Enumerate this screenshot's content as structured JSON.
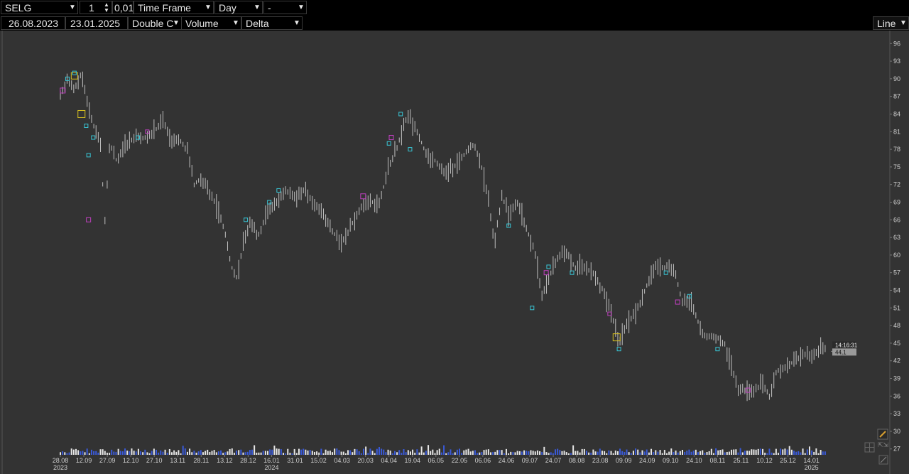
{
  "toolbar": {
    "symbol": "SELG",
    "multiplier": "1",
    "tick_size": "0,01",
    "timeframe_label": "Time Frame",
    "period": "Day",
    "extra": "-",
    "date_from": "26.08.2023",
    "date_to": "23.01.2025",
    "chart_style": "Double C",
    "volume_label": "Volume",
    "delta_label": "Delta",
    "draw_mode": "Line"
  },
  "price_label": {
    "time": "14:16:31",
    "price": "44,1"
  },
  "colors": {
    "background": "#333333",
    "toolbar": "#000000",
    "bar": "#bfbfbf",
    "cyan_marker": "#39c6d6",
    "magenta_marker": "#c040c0",
    "yellow_marker": "#d8c020",
    "volume_white": "#e6e6e6",
    "volume_blue": "#3a5ad8",
    "last_price_bg": "#9a9a9a"
  },
  "chart_data": {
    "type": "line",
    "ylim": [
      26,
      97
    ],
    "y_ticks": [
      "96",
      "93",
      "90",
      "87",
      "84",
      "81",
      "78",
      "75",
      "72",
      "69",
      "66",
      "63",
      "60",
      "57",
      "54",
      "51",
      "48",
      "45",
      "42",
      "39",
      "36",
      "33",
      "30",
      "27"
    ],
    "x_ticks": [
      {
        "label": "28.08",
        "sub": "2023"
      },
      {
        "label": "12.09"
      },
      {
        "label": "27.09"
      },
      {
        "label": "12.10"
      },
      {
        "label": "27.10"
      },
      {
        "label": "13.11"
      },
      {
        "label": "28.11"
      },
      {
        "label": "13.12"
      },
      {
        "label": "28.12"
      },
      {
        "label": "16.01",
        "sub": "2024"
      },
      {
        "label": "31.01"
      },
      {
        "label": "15.02"
      },
      {
        "label": "04.03"
      },
      {
        "label": "20.03"
      },
      {
        "label": "04.04"
      },
      {
        "label": "19.04"
      },
      {
        "label": "06.05"
      },
      {
        "label": "22.05"
      },
      {
        "label": "06.06"
      },
      {
        "label": "24.06"
      },
      {
        "label": "09.07"
      },
      {
        "label": "24.07"
      },
      {
        "label": "08.08"
      },
      {
        "label": "23.08"
      },
      {
        "label": "09.09"
      },
      {
        "label": "24.09"
      },
      {
        "label": "09.10"
      },
      {
        "label": "24.10"
      },
      {
        "label": "08.11"
      },
      {
        "label": "25.11"
      },
      {
        "label": "10.12"
      },
      {
        "label": "25.12"
      },
      {
        "label": "14.01",
        "sub": "2025"
      }
    ],
    "price_path": [
      [
        0,
        87
      ],
      [
        0.3,
        90
      ],
      [
        0.6,
        88
      ],
      [
        0.9,
        91
      ],
      [
        1.2,
        85
      ],
      [
        1.5,
        81
      ],
      [
        1.7,
        79
      ],
      [
        1.9,
        66
      ],
      [
        2.1,
        79
      ],
      [
        2.4,
        76
      ],
      [
        2.8,
        79
      ],
      [
        3.2,
        80
      ],
      [
        3.6,
        80
      ],
      [
        4.0,
        81
      ],
      [
        4.4,
        83
      ],
      [
        4.7,
        79
      ],
      [
        5.0,
        80
      ],
      [
        5.4,
        78
      ],
      [
        5.7,
        72
      ],
      [
        6.0,
        73
      ],
      [
        6.3,
        71
      ],
      [
        6.7,
        68
      ],
      [
        7.0,
        64
      ],
      [
        7.3,
        58
      ],
      [
        7.5,
        56
      ],
      [
        7.8,
        62
      ],
      [
        8.1,
        66
      ],
      [
        8.4,
        63
      ],
      [
        8.8,
        67
      ],
      [
        9.2,
        69
      ],
      [
        9.6,
        71
      ],
      [
        10.0,
        70
      ],
      [
        10.4,
        71
      ],
      [
        10.8,
        69
      ],
      [
        11.2,
        67
      ],
      [
        11.6,
        64
      ],
      [
        12.0,
        62
      ],
      [
        12.4,
        65
      ],
      [
        12.8,
        68
      ],
      [
        13.2,
        69
      ],
      [
        13.6,
        69
      ],
      [
        14.0,
        75
      ],
      [
        14.4,
        79
      ],
      [
        14.8,
        84
      ],
      [
        15.2,
        81
      ],
      [
        15.6,
        77
      ],
      [
        16.0,
        76
      ],
      [
        16.4,
        74
      ],
      [
        16.8,
        75
      ],
      [
        17.2,
        77
      ],
      [
        17.6,
        79
      ],
      [
        17.9,
        76
      ],
      [
        18.2,
        70
      ],
      [
        18.5,
        62
      ],
      [
        18.8,
        70
      ],
      [
        19.1,
        67
      ],
      [
        19.5,
        69
      ],
      [
        19.8,
        65
      ],
      [
        20.2,
        61
      ],
      [
        20.5,
        53
      ],
      [
        20.8,
        56
      ],
      [
        21.1,
        59
      ],
      [
        21.5,
        61
      ],
      [
        21.9,
        58
      ],
      [
        22.3,
        58
      ],
      [
        22.7,
        57
      ],
      [
        23.1,
        54
      ],
      [
        23.5,
        50
      ],
      [
        23.8,
        45
      ],
      [
        24.1,
        48
      ],
      [
        24.5,
        50
      ],
      [
        24.9,
        54
      ],
      [
        25.3,
        58
      ],
      [
        25.7,
        58
      ],
      [
        26.0,
        58
      ],
      [
        26.2,
        57
      ],
      [
        26.5,
        52
      ],
      [
        26.9,
        52
      ],
      [
        27.3,
        47
      ],
      [
        27.6,
        46
      ],
      [
        28.0,
        46
      ],
      [
        28.3,
        45
      ],
      [
        28.6,
        41
      ],
      [
        28.9,
        37
      ],
      [
        29.2,
        37
      ],
      [
        29.6,
        37
      ],
      [
        29.9,
        38
      ],
      [
        30.2,
        36
      ],
      [
        30.5,
        40
      ],
      [
        30.9,
        41
      ],
      [
        31.3,
        42
      ],
      [
        31.7,
        43
      ],
      [
        32.1,
        43
      ],
      [
        32.4,
        44
      ],
      [
        32.6,
        44.1
      ]
    ],
    "last_price": 44.1
  }
}
